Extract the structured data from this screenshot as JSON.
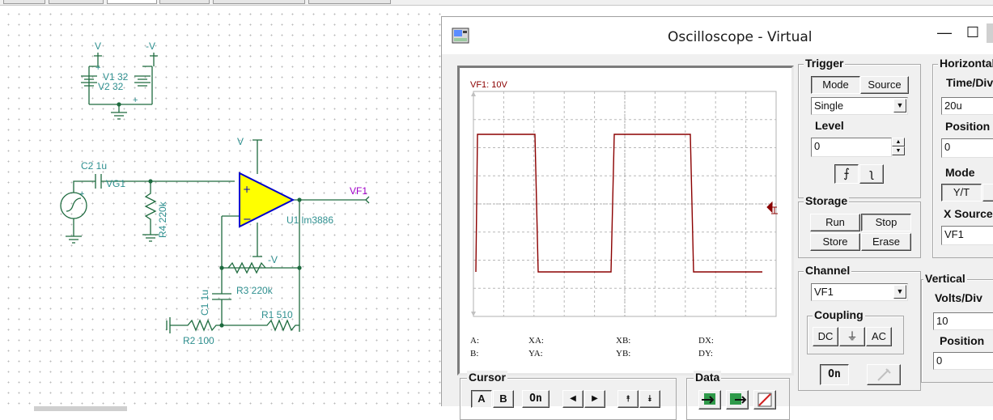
{
  "schematic": {
    "node_v": "V",
    "node_neg_v": "-V",
    "v1_label": "V1 32",
    "v2_label": "V2 32",
    "c2_label": "C2 1u",
    "vg1_label": "VG1",
    "r4_label": "R4 220k",
    "u1_label": "U1 lm3886",
    "vf1_label": "VF1",
    "r3_label": "R3 220k",
    "c1_label": "C1 1u",
    "r1_label": "R1 510",
    "r2_label": "R2 100",
    "opamp_plus": "+",
    "opamp_minus": "−",
    "supply_v_pin": "V",
    "supply_negv_pin": "-V",
    "plus_sign": "+",
    "wire_color": "#1e6b3f",
    "label_color": "#2e8f8f",
    "opamp_fill": "#ffff00",
    "opamp_outline": "#0000cc",
    "vf1_color": "#a000c8"
  },
  "oscilloscope": {
    "title": "Oscilloscope - Virtual",
    "minimize_glyph": "—",
    "maximize_glyph": "☐",
    "screen": {
      "channel_label": "VF1: 10V",
      "trace_color": "#8b0000",
      "readout": {
        "a": "A:",
        "b": "B:",
        "xa": "XA:",
        "ya": "YA:",
        "xb": "XB:",
        "yb": "YB:",
        "dx": "DX:",
        "dy": "DY:"
      }
    },
    "trigger": {
      "title": "Trigger",
      "mode_button": "Mode",
      "source_button": "Source",
      "mode_value": "Single",
      "level_label": "Level",
      "level_value": "0",
      "rising_glyph": "⨍",
      "falling_glyph": "ʅ"
    },
    "storage": {
      "title": "Storage",
      "run": "Run",
      "stop": "Stop",
      "store": "Store",
      "erase": "Erase"
    },
    "channel": {
      "title": "Channel",
      "value": "VF1",
      "coupling_title": "Coupling",
      "dc": "DC",
      "gnd": "⏚",
      "ac": "AC",
      "on": "On"
    },
    "horizontal": {
      "title": "Horizontal",
      "time_div_label": "Time/Div",
      "time_div_value": "20u",
      "position_label": "Position",
      "position_value": "0",
      "mode_label": "Mode",
      "mode_yt": "Y/T",
      "x_source_label": "X Source",
      "x_source_value": "VF1"
    },
    "vertical": {
      "title": "Vertical",
      "volts_div_label": "Volts/Div",
      "volts_div_value": "10",
      "position_label": "Position",
      "position_value": "0"
    },
    "cursor": {
      "title": "Cursor",
      "a": "A",
      "b": "B",
      "on": "On",
      "left": "◀",
      "right": "▶",
      "up": "⯭",
      "down": "⯯"
    },
    "data": {
      "title": "Data"
    }
  }
}
